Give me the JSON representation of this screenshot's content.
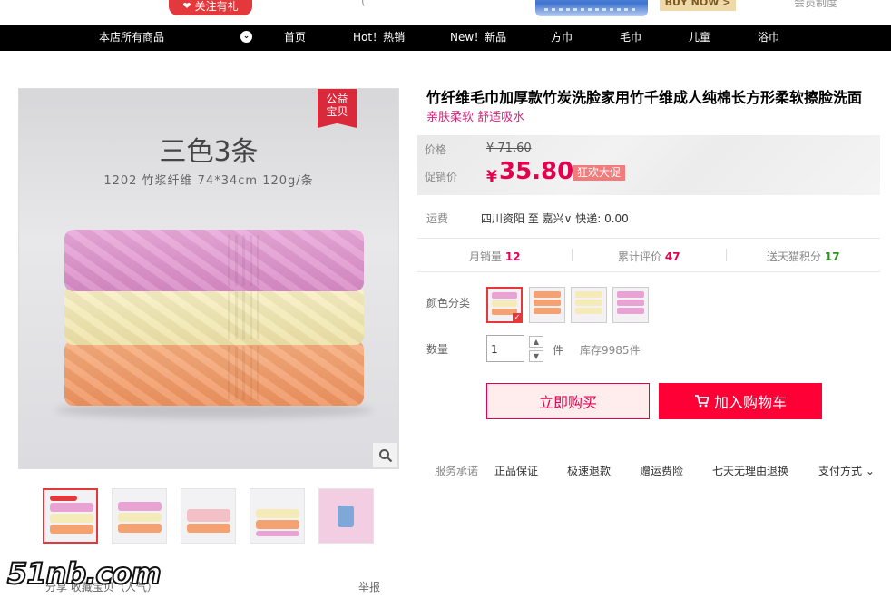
{
  "top": {
    "follow_label": "关注有礼",
    "paren_text": "(",
    "buy_now": "BUY NOW >",
    "right_text": "会员制度"
  },
  "nav": {
    "items": [
      "本店所有商品",
      "首页",
      "Hot！热销",
      "New！新品",
      "方巾",
      "毛巾",
      "儿童",
      "浴巾"
    ]
  },
  "gallery": {
    "badge_line1": "公益",
    "badge_line2": "宝贝",
    "image_title": "三色3条",
    "image_subtitle": "1202  竹浆纤维  74*34cm 120g/条"
  },
  "product": {
    "title": "竹纤维毛巾加厚款竹炭洗脸家用竹千维成人纯棉长方形柔软擦脸洗面",
    "subtitle": "亲肤柔软 舒适吸水",
    "price_label": "价格",
    "original_price": "¥ 71.60",
    "promo_label": "促销价",
    "currency": "¥",
    "promo_price": "35.80",
    "promo_tag": "狂欢大促",
    "shipping_label": "运费",
    "shipping_value": "四川资阳 至 嘉兴∨ 快递: 0.00",
    "monthly_sales_label": "月销量",
    "monthly_sales": "12",
    "reviews_label": "累计评价",
    "reviews": "47",
    "points_label": "送天猫积分",
    "points": "17",
    "color_label": "颜色分类",
    "quantity_label": "数量",
    "quantity_value": "1",
    "unit": "件",
    "stock": "库存9985件",
    "buy_now": "立即购买",
    "add_to_cart": "加入购物车",
    "service_label": "服务承诺",
    "services": [
      "正品保证",
      "极速退款",
      "赠运费险",
      "七天无理由退换"
    ],
    "payment": "支付方式"
  },
  "bottom": {
    "left_text": "分享  收藏宝贝（人气）",
    "report": "举报",
    "watermark": "51nb.com"
  },
  "colors": {
    "accent": "#e4004f",
    "nav_bg": "#000000",
    "cart_bg": "#ff0036"
  }
}
